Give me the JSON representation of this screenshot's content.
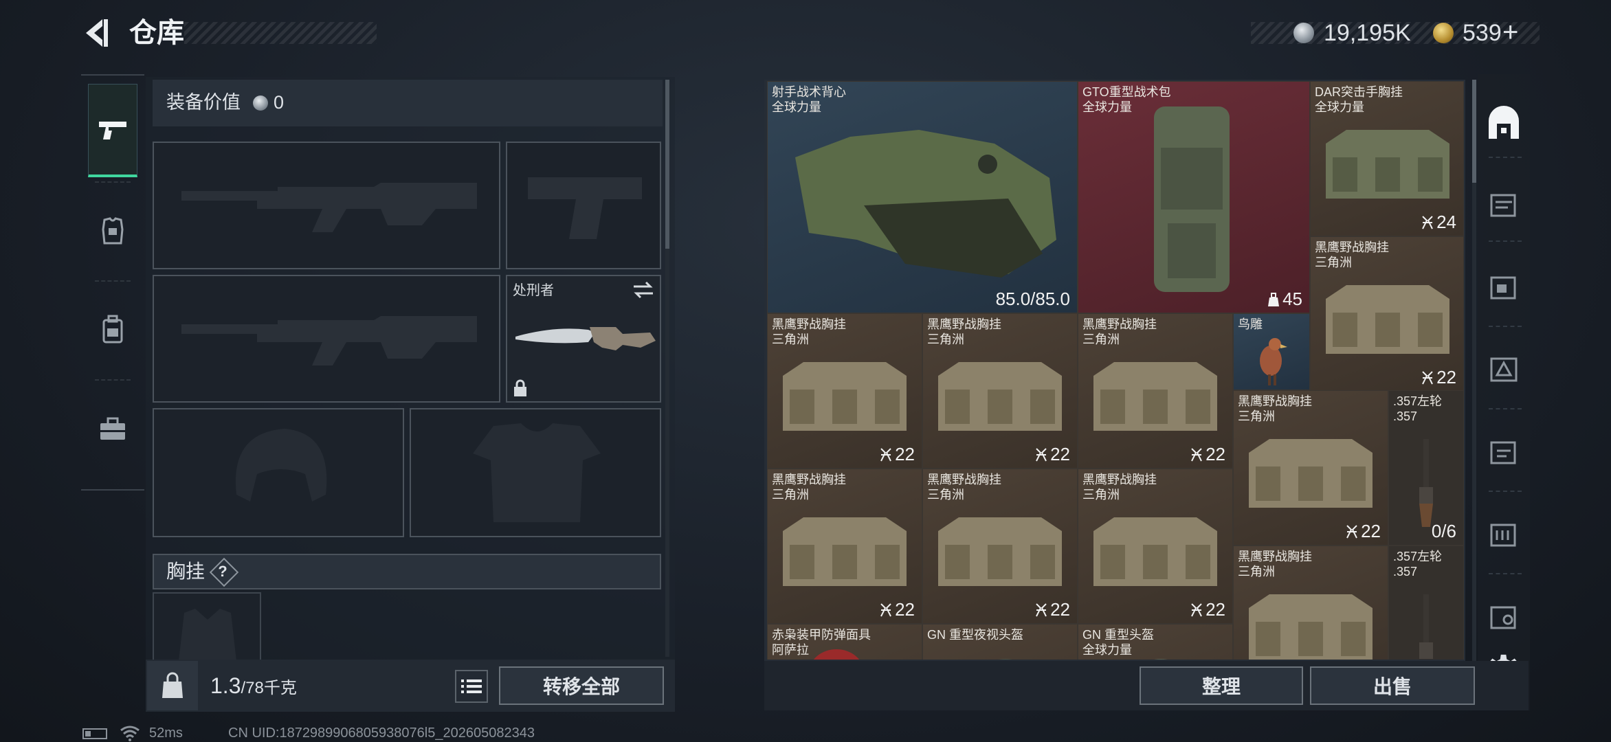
{
  "header": {
    "title": "仓库",
    "currency_silver": "19,195K",
    "currency_gold": "539",
    "add_label": "+"
  },
  "equipment": {
    "value_label": "装备价值",
    "value": "0",
    "melee_name": "处刑者",
    "chest_label": "胸挂",
    "help_label": "?"
  },
  "footer_left": {
    "weight_current": "1.3",
    "weight_max": "/78",
    "weight_unit": "千克",
    "move_all_label": "转移全部"
  },
  "footer_right": {
    "sort_label": "整理",
    "sell_label": "出售"
  },
  "inventory": [
    {
      "name": "射手战术背心",
      "sub": "全球力量",
      "count": "85.0/85.0"
    },
    {
      "name": "GTO重型战术包",
      "sub": "全球力量",
      "count": "45"
    },
    {
      "name": "DAR突击手胸挂",
      "sub": "全球力量",
      "count": "24"
    },
    {
      "name": "黑鹰野战胸挂",
      "sub": "三角洲",
      "count": "22"
    },
    {
      "name": "黑鹰野战胸挂",
      "sub": "三角洲",
      "count": "22"
    },
    {
      "name": "黑鹰野战胸挂",
      "sub": "三角洲",
      "count": "22"
    },
    {
      "name": "黑鹰野战胸挂",
      "sub": "三角洲",
      "count": "22"
    },
    {
      "name": "鸟雕",
      "sub": "",
      "count": ""
    },
    {
      "name": "黑鹰野战胸挂",
      "sub": "三角洲",
      "count": "22"
    },
    {
      "name": "黑鹰野战胸挂",
      "sub": "三角洲",
      "count": "22"
    },
    {
      "name": "黑鹰野战胸挂",
      "sub": "三角洲",
      "count": "22"
    },
    {
      "name": "黑鹰野战胸挂",
      "sub": "三角洲",
      "count": "22"
    },
    {
      "name": ".357左轮",
      "sub": ".357",
      "count": "0/6"
    },
    {
      "name": "黑鹰野战胸挂",
      "sub": "三角洲",
      "count": ""
    },
    {
      "name": ".357左轮",
      "sub": ".357",
      "count": ""
    },
    {
      "name": "赤枭装甲防弹面具",
      "sub": "阿萨拉",
      "count": ""
    },
    {
      "name": "GN 重型夜视头盔",
      "sub": "",
      "count": ""
    },
    {
      "name": "GN 重型头盔",
      "sub": "全球力量",
      "count": ""
    }
  ],
  "status": {
    "ping": "52ms",
    "uid": "CN UID:1872989906805938076l5_202605082343"
  }
}
